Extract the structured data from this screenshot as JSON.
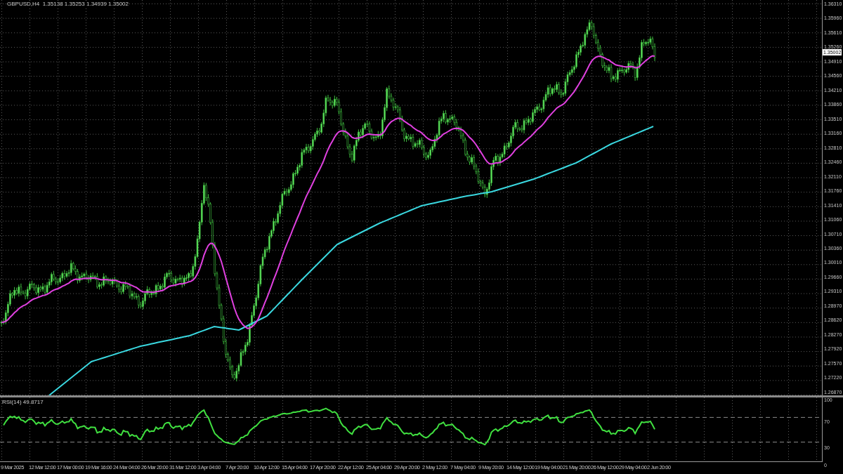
{
  "header": {
    "text": "GBPUSD,H4  1.35138 1.35253 1.34939 1.35002"
  },
  "price_axis": [
    "1.36310",
    "1.35960",
    "1.35610",
    "1.35260",
    "1.34910",
    "1.34560",
    "1.34210",
    "1.33860",
    "1.33510",
    "1.33160",
    "1.32810",
    "1.32460",
    "1.32110",
    "1.31760",
    "1.31410",
    "1.31060",
    "1.30710",
    "1.30360",
    "1.30010",
    "1.29660",
    "1.29310",
    "1.28970",
    "1.28620",
    "1.28270",
    "1.27920",
    "1.27570",
    "1.27220",
    "1.26870"
  ],
  "current_price": "1.35002",
  "rsi": {
    "label": "RSI(14) 49.8717",
    "levels": [
      "100",
      "70",
      "30",
      "0"
    ]
  },
  "time_axis": [
    "9 Mar 2025",
    "12 Mar 12:00",
    "17 Mar 00:00",
    "19 Mar 16:00",
    "24 Mar 04:00",
    "26 Mar 20:00",
    "31 Mar 12:00",
    "3 Apr 04:00",
    "7 Apr 20:00",
    "10 Apr 12:00",
    "15 Apr 04:00",
    "17 Apr 20:00",
    "22 Apr 12:00",
    "25 Apr 04:00",
    "29 Apr 20:00",
    "2 May 12:00",
    "7 May 04:00",
    "9 May 20:00",
    "14 May 12:00",
    "19 May 04:00",
    "21 May 20:00",
    "26 May 12:00",
    "29 May 04:00",
    "2 Jun 20:00"
  ]
}
